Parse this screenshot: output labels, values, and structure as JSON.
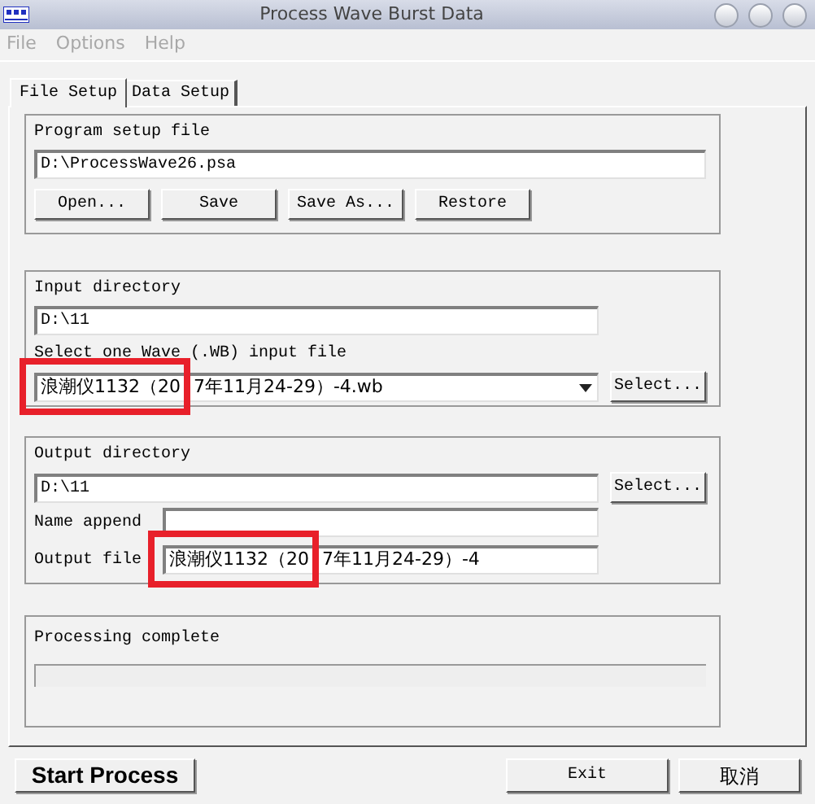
{
  "window": {
    "title": "Process Wave Burst Data"
  },
  "menu": [
    {
      "label": "File",
      "disabled": true
    },
    {
      "label": "Options",
      "disabled": true
    },
    {
      "label": "Help",
      "disabled": true
    }
  ],
  "tabs": [
    {
      "label": "File Setup",
      "selected": true
    },
    {
      "label": "Data Setup",
      "selected": false
    }
  ],
  "setup_group": {
    "label": "Program setup file",
    "value": "D:\\ProcessWave26.psa",
    "buttons": [
      "Open...",
      "Save",
      "Save As...",
      "Restore"
    ]
  },
  "input_group": {
    "label": "Input directory",
    "directory": "D:\\11",
    "file_label": "Select one Wave (.WB) input file",
    "file_value_highlighted": "浪潮仪1132（20",
    "file_value_rest": "7年11月24-29）-4.wb",
    "select_button": "Select..."
  },
  "output_group": {
    "label": "Output directory",
    "directory": "D:\\11",
    "select_button": "Select...",
    "name_append_label": "Name append",
    "output_file_label": "Output file",
    "output_value_highlighted": "浪潮仪1132（20",
    "output_value_rest": "7年11月24-29）-4"
  },
  "progress_group": {
    "label": "Processing complete",
    "level": 0
  },
  "buttons": [
    "Start Process",
    "Exit",
    "取消"
  ]
}
